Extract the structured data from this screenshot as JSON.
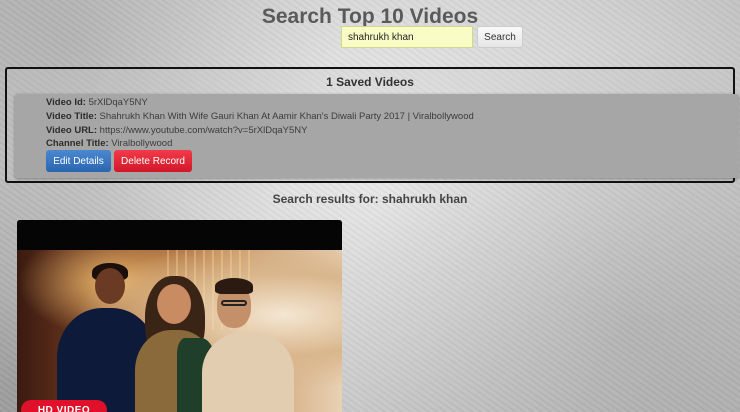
{
  "page": {
    "title": "Search Top 10 Videos"
  },
  "search": {
    "value": "shahrukh khan",
    "button_label": "Search"
  },
  "saved": {
    "heading": "1 Saved Videos",
    "records": [
      {
        "id_label": "Video Id:",
        "id_value": "5rXlDqaY5NY",
        "title_label": "Video Title:",
        "title_value": "Shahrukh Khan With Wife Gauri Khan At Aamir Khan's Diwali Party 2017 | Viralbollywood",
        "url_label": "Video URL:",
        "url_value": "https://www.youtube.com/watch?v=5rXlDqaY5NY",
        "channel_label": "Channel Title:",
        "channel_value": "Viralbollywood",
        "edit_label": "Edit Details",
        "delete_label": "Delete Record"
      }
    ]
  },
  "results": {
    "heading": "Search results for: shahrukh khan",
    "items": [
      {
        "badge": "HD VIDEO"
      }
    ]
  },
  "colors": {
    "edit_button": "#2a66b0",
    "delete_button": "#d01828",
    "search_input_bg": "#fafcc6",
    "badge": "#e0102a"
  }
}
